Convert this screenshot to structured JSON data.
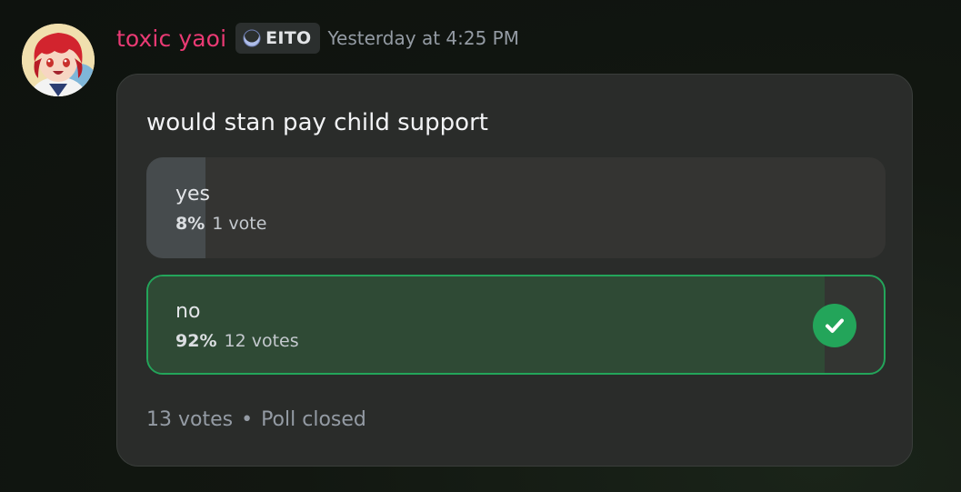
{
  "message": {
    "author": {
      "username": "toxic yaoi",
      "username_color": "#ea3a74",
      "avatar_icon": "anime-character-avatar",
      "tag": {
        "icon": "moon-crescent-icon",
        "label": "EITO"
      }
    },
    "timestamp": "Yesterday at 4:25 PM"
  },
  "poll": {
    "question": "would stan pay child support",
    "answers": [
      {
        "label": "yes",
        "percent_text": "8%",
        "votes_text": "1 vote",
        "share": 0.08,
        "selected": false
      },
      {
        "label": "no",
        "percent_text": "92%",
        "votes_text": "12 votes",
        "share": 0.92,
        "selected": true,
        "selected_icon": "checkmark-icon",
        "accent": "#23a55a"
      }
    ],
    "footer": {
      "total_votes": "13 votes",
      "separator": "•",
      "status": "Poll closed"
    }
  }
}
